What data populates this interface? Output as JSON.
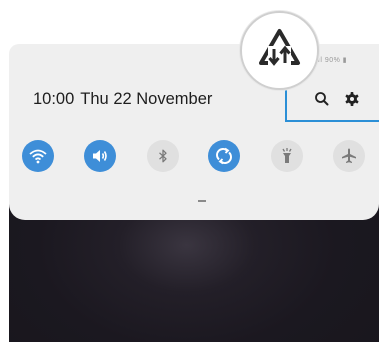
{
  "status_bar": {
    "right_text": "..ıl 90% ▮"
  },
  "panel": {
    "time": "10:00",
    "date": "Thu 22 November"
  },
  "top_actions": [
    {
      "name": "search",
      "icon": "search-icon"
    },
    {
      "name": "settings",
      "icon": "gear-icon"
    }
  ],
  "quick_settings": [
    {
      "name": "wifi",
      "icon": "wifi-icon",
      "state": "on"
    },
    {
      "name": "sound",
      "icon": "volume-icon",
      "state": "on"
    },
    {
      "name": "bluetooth",
      "icon": "bluetooth-icon",
      "state": "off"
    },
    {
      "name": "auto-rotate",
      "icon": "auto-rotate-icon",
      "state": "on"
    },
    {
      "name": "flashlight",
      "icon": "flashlight-icon",
      "state": "off"
    },
    {
      "name": "airplane-mode",
      "icon": "airplane-icon",
      "state": "off"
    }
  ],
  "colors": {
    "accent": "#3e8ed8",
    "callout": "#2b8fd6",
    "panel": "#efefef"
  },
  "magnifier": {
    "icon": "data-sync-arrows-icon"
  }
}
